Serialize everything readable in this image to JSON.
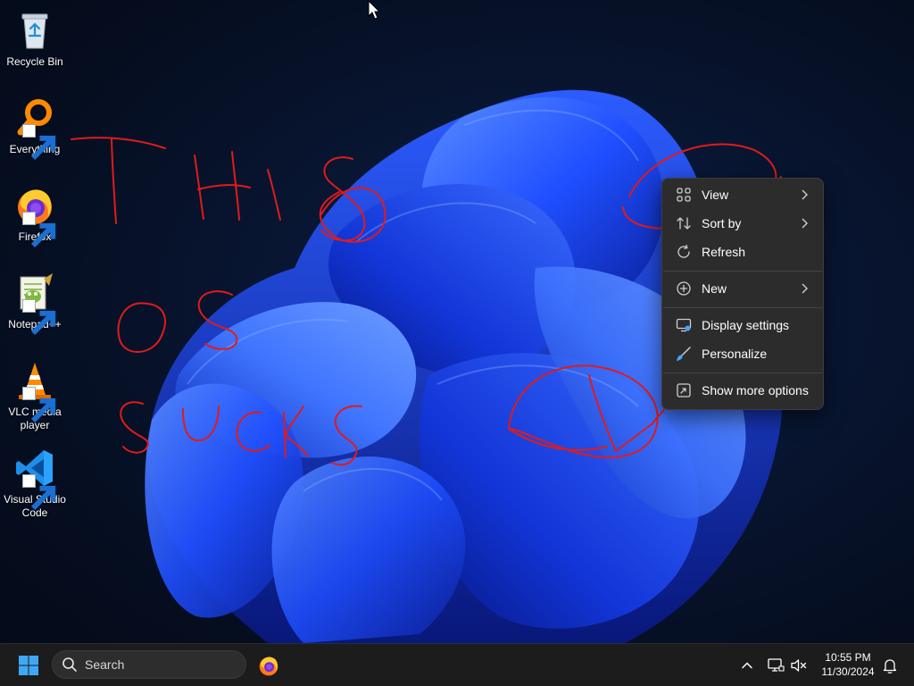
{
  "desktop": {
    "icons": [
      {
        "label": "Recycle Bin",
        "icon": "recycle-bin-icon"
      },
      {
        "label": "Everything",
        "icon": "everything-search-icon"
      },
      {
        "label": "Firefox",
        "icon": "firefox-icon"
      },
      {
        "label": "Notepad++",
        "icon": "notepadpp-icon"
      },
      {
        "label": "VLC media player",
        "icon": "vlc-icon"
      },
      {
        "label": "Visual Studio Code",
        "icon": "vscode-icon"
      }
    ],
    "scribble_color": "#e01b1b",
    "wallpaper_accent": "#1f4fff"
  },
  "context_menu": {
    "items": [
      {
        "label": "View",
        "icon": "view-grid-icon",
        "submenu": true
      },
      {
        "label": "Sort by",
        "icon": "sort-icon",
        "submenu": true
      },
      {
        "label": "Refresh",
        "icon": "refresh-icon",
        "submenu": false
      },
      {
        "label": "New",
        "icon": "new-plus-icon",
        "submenu": true
      },
      {
        "label": "Display settings",
        "icon": "display-settings-icon",
        "submenu": false
      },
      {
        "label": "Personalize",
        "icon": "personalize-brush-icon",
        "submenu": false
      },
      {
        "label": "Show more options",
        "icon": "more-options-icon",
        "submenu": false
      }
    ]
  },
  "taskbar": {
    "search_placeholder": "Search",
    "pinned": [
      {
        "icon": "firefox-icon"
      }
    ],
    "tray": {
      "chevron": "chevron-up-icon",
      "network": "network-icon",
      "volume": "volume-muted-icon",
      "notifications": "notification-bell-icon"
    },
    "time": "10:55 PM",
    "date": "11/30/2024"
  }
}
